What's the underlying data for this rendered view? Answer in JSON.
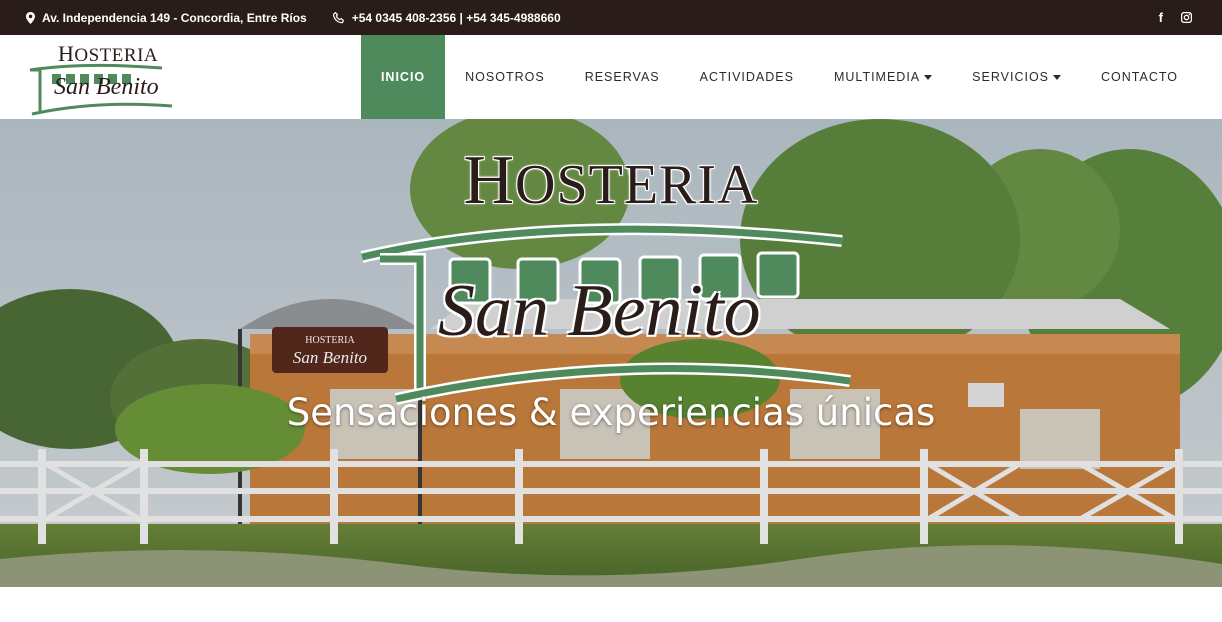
{
  "colors": {
    "topbar_bg": "#2a1d19",
    "accent_green": "#4e8a5c",
    "brand_brown": "#2a1d19"
  },
  "topbar": {
    "address": "Av. Independencia 149 - Concordia, Entre Ríos",
    "phones": "+54 0345 408-2356 | +54 345-4988660",
    "address_icon": "map-marker-icon",
    "phone_icon": "phone-icon",
    "social": [
      {
        "icon": "facebook-icon",
        "glyph": "f"
      },
      {
        "icon": "instagram-icon"
      }
    ]
  },
  "logo": {
    "line1": "Hosteria",
    "line1_cap": "H",
    "line1_rest": "OSTERIA",
    "line2": "San Benito"
  },
  "menu": {
    "items": [
      {
        "label": "INICIO",
        "active": true
      },
      {
        "label": "NOSOTROS"
      },
      {
        "label": "RESERVAS"
      },
      {
        "label": "ACTIVIDADES"
      },
      {
        "label": "MULTIMEDIA",
        "dropdown": true
      },
      {
        "label": "SERVICIOS",
        "dropdown": true
      },
      {
        "label": "CONTACTO"
      }
    ]
  },
  "hero": {
    "title_cap": "H",
    "title_rest": "OSTERIA",
    "script": "San Benito",
    "tagline": "Sensaciones & experiencias únicas",
    "sign_line1": "HOSTERIA",
    "sign_line2": "San Benito"
  }
}
